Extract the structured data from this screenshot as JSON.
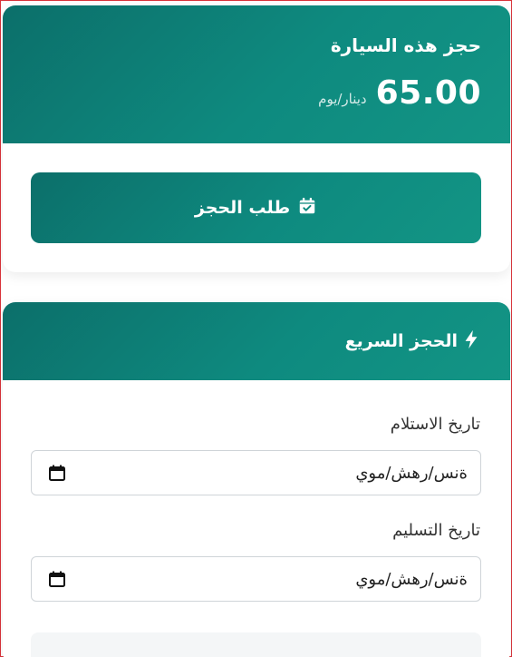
{
  "booking": {
    "title": "حجز هذه السيارة",
    "price": "65.00",
    "unit": "دينار/يوم",
    "button_label": "طلب الحجز",
    "button_icon": "calendar-check-icon"
  },
  "quick_booking": {
    "title": "الحجز السريع",
    "title_icon": "bolt-icon",
    "pickup_label": "تاريخ الاستلام",
    "pickup_value": "ةنس/رهش/موي",
    "return_label": "تاريخ التسليم",
    "return_value": "ةنس/رهش/موي",
    "date_icon": "calendar-icon"
  },
  "colors": {
    "accent_dark": "#0c6f6a",
    "accent_light": "#139585",
    "frame_border": "#d9333a"
  }
}
